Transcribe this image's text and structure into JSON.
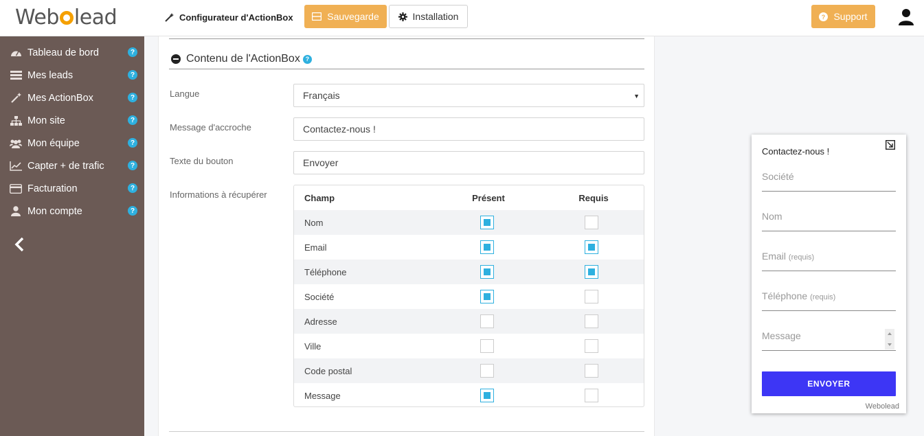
{
  "header": {
    "logo_text": "Webolead",
    "page_title": "Configurateur d'ActionBox",
    "save_label": "Sauvegarde",
    "install_label": "Installation",
    "support_label": "Support"
  },
  "sidebar": {
    "items": [
      {
        "label": "Tableau de bord",
        "icon": "dashboard-icon"
      },
      {
        "label": "Mes leads",
        "icon": "list-icon"
      },
      {
        "label": "Mes ActionBox",
        "icon": "magic-wand-icon"
      },
      {
        "label": "Mon site",
        "icon": "sitemap-icon"
      },
      {
        "label": "Mon équipe",
        "icon": "users-icon"
      },
      {
        "label": "Capter + de trafic",
        "icon": "line-chart-icon"
      },
      {
        "label": "Facturation",
        "icon": "credit-card-icon"
      },
      {
        "label": "Mon compte",
        "icon": "user-icon"
      }
    ]
  },
  "main": {
    "section_title": "Contenu de l'ActionBox",
    "fields": {
      "langue_label": "Langue",
      "langue_value": "Français",
      "accroche_label": "Message d'accroche",
      "accroche_value": "Contactez-nous !",
      "bouton_label": "Texte du bouton",
      "bouton_value": "Envoyer",
      "infos_label": "Informations à récupérer"
    },
    "table": {
      "headers": [
        "Champ",
        "Présent",
        "Requis"
      ],
      "rows": [
        {
          "champ": "Nom",
          "present": true,
          "requis": false
        },
        {
          "champ": "Email",
          "present": true,
          "requis": true
        },
        {
          "champ": "Téléphone",
          "present": true,
          "requis": true
        },
        {
          "champ": "Société",
          "present": true,
          "requis": false
        },
        {
          "champ": "Adresse",
          "present": false,
          "requis": false
        },
        {
          "champ": "Ville",
          "present": false,
          "requis": false
        },
        {
          "champ": "Code postal",
          "present": false,
          "requis": false
        },
        {
          "champ": "Message",
          "present": true,
          "requis": false
        }
      ]
    }
  },
  "preview": {
    "title": "Contactez-nous !",
    "fields": [
      {
        "label": "Société",
        "note": ""
      },
      {
        "label": "Nom",
        "note": ""
      },
      {
        "label": "Email",
        "note": "(requis)"
      },
      {
        "label": "Téléphone",
        "note": "(requis)"
      },
      {
        "label": "Message",
        "note": ""
      }
    ],
    "button_label": "ENVOYER",
    "brand": "Webolead"
  },
  "colors": {
    "accent_orange": "#f0b054",
    "sidebar_bg": "#6b5a55",
    "help_blue": "#2eb0df",
    "checkbox_blue": "#2eb0df",
    "preview_button": "#3d36f5"
  }
}
